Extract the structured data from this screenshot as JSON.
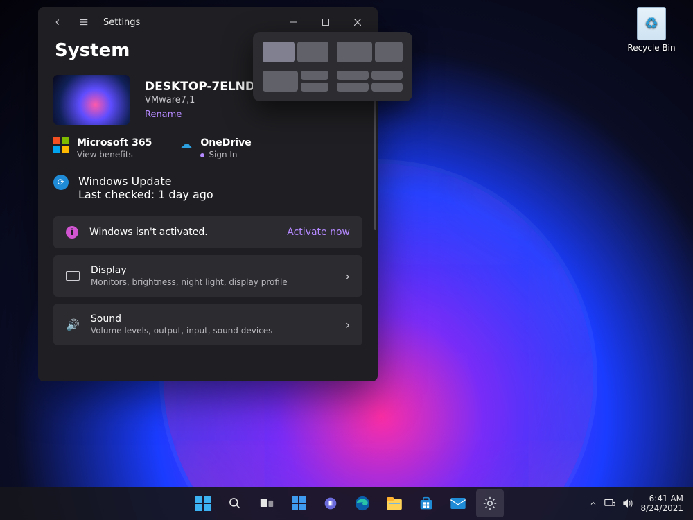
{
  "desktop": {
    "recycle_bin": "Recycle Bin"
  },
  "window": {
    "title": "Settings",
    "page": "System",
    "device": {
      "name": "DESKTOP-7ELNDNI",
      "model": "VMware7,1",
      "rename": "Rename"
    },
    "quick": {
      "m365_title": "Microsoft 365",
      "m365_sub": "View benefits",
      "onedrive_title": "OneDrive",
      "onedrive_sub": "Sign In",
      "wu_title": "Windows Update",
      "wu_sub": "Last checked: 1 day ago"
    },
    "activation": {
      "text": "Windows isn't activated.",
      "action": "Activate now"
    },
    "items": [
      {
        "title": "Display",
        "sub": "Monitors, brightness, night light, display profile"
      },
      {
        "title": "Sound",
        "sub": "Volume levels, output, input, sound devices"
      }
    ]
  },
  "taskbar": {
    "time": "6:41 AM",
    "date": "8/24/2021"
  }
}
